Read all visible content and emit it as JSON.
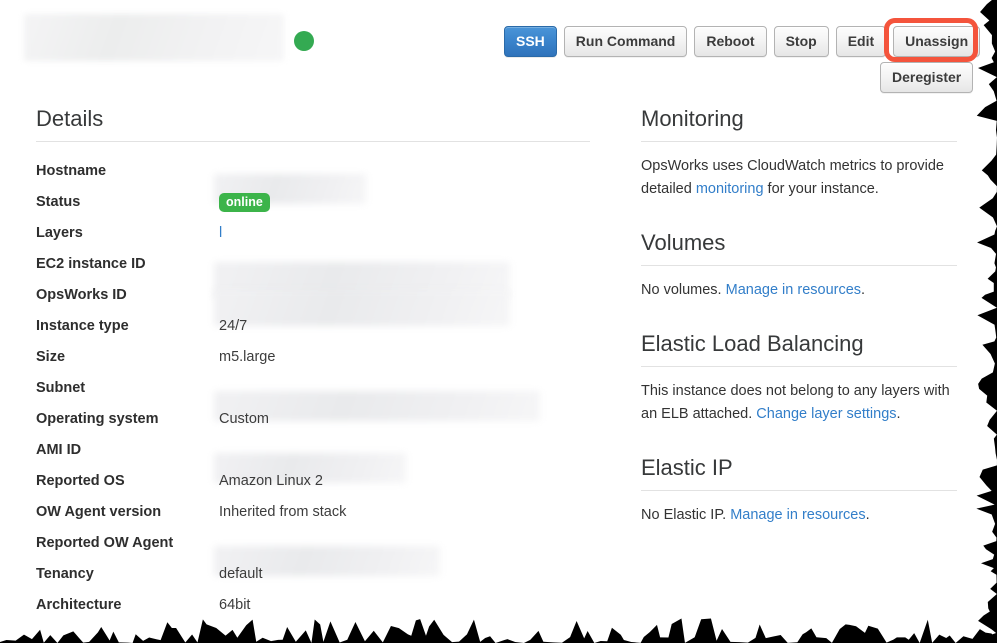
{
  "header": {
    "title_redacted": "",
    "status_indicator": "green-dot",
    "buttons": [
      {
        "label": "SSH",
        "style": "primary",
        "name": "ssh-button"
      },
      {
        "label": "Run Command",
        "style": "default",
        "name": "run-command-button"
      },
      {
        "label": "Reboot",
        "style": "default",
        "name": "reboot-button"
      },
      {
        "label": "Stop",
        "style": "default",
        "name": "stop-button"
      },
      {
        "label": "Edit",
        "style": "default",
        "name": "edit-button"
      },
      {
        "label": "Unassign",
        "style": "default",
        "name": "unassign-button"
      }
    ],
    "deregister_label": "Deregister",
    "annotation_color": "#f4543c",
    "annotated_button": "Unassign"
  },
  "details": {
    "heading": "Details",
    "rows": [
      {
        "label": "Hostname",
        "value": "",
        "kind": "redacted"
      },
      {
        "label": "Status",
        "value": "online",
        "kind": "badge"
      },
      {
        "label": "Layers",
        "value": "l",
        "kind": "link"
      },
      {
        "label": "EC2 instance ID",
        "value": "",
        "kind": "redacted"
      },
      {
        "label": "OpsWorks ID",
        "value": "",
        "kind": "redacted"
      },
      {
        "label": "Instance type",
        "value": "24/7",
        "kind": "text"
      },
      {
        "label": "Size",
        "value": "m5.large",
        "kind": "text"
      },
      {
        "label": "Subnet",
        "value": "",
        "kind": "redacted"
      },
      {
        "label": "Operating system",
        "value": "Custom",
        "kind": "text"
      },
      {
        "label": "AMI ID",
        "value": "",
        "kind": "redacted"
      },
      {
        "label": "Reported OS",
        "value": "Amazon Linux 2",
        "kind": "text"
      },
      {
        "label": "OW Agent version",
        "value": "Inherited from stack",
        "kind": "text"
      },
      {
        "label": "Reported OW Agent",
        "value": "",
        "kind": "redacted"
      },
      {
        "label": "Tenancy",
        "value": "default",
        "kind": "text"
      },
      {
        "label": "Architecture",
        "value": "64bit",
        "kind": "text"
      }
    ]
  },
  "monitoring": {
    "heading": "Monitoring",
    "text_before": "OpsWorks uses CloudWatch metrics to provide detailed ",
    "link": "monitoring",
    "text_after": " for your instance."
  },
  "volumes": {
    "heading": "Volumes",
    "text_before": "No volumes. ",
    "link": "Manage in resources",
    "text_after": "."
  },
  "elb": {
    "heading": "Elastic Load Balancing",
    "text_before": "This instance does not belong to any layers with an ELB attached. ",
    "link": "Change layer settings",
    "text_after": "."
  },
  "elastic_ip": {
    "heading": "Elastic IP",
    "text_before": "No Elastic IP. ",
    "link": "Manage in resources",
    "text_after": "."
  },
  "colors": {
    "primary_button": "#3a83cb",
    "status_badge": "#3cb44a",
    "status_dot": "#34aa52",
    "link": "#327ec9",
    "annotation": "#f4543c"
  }
}
